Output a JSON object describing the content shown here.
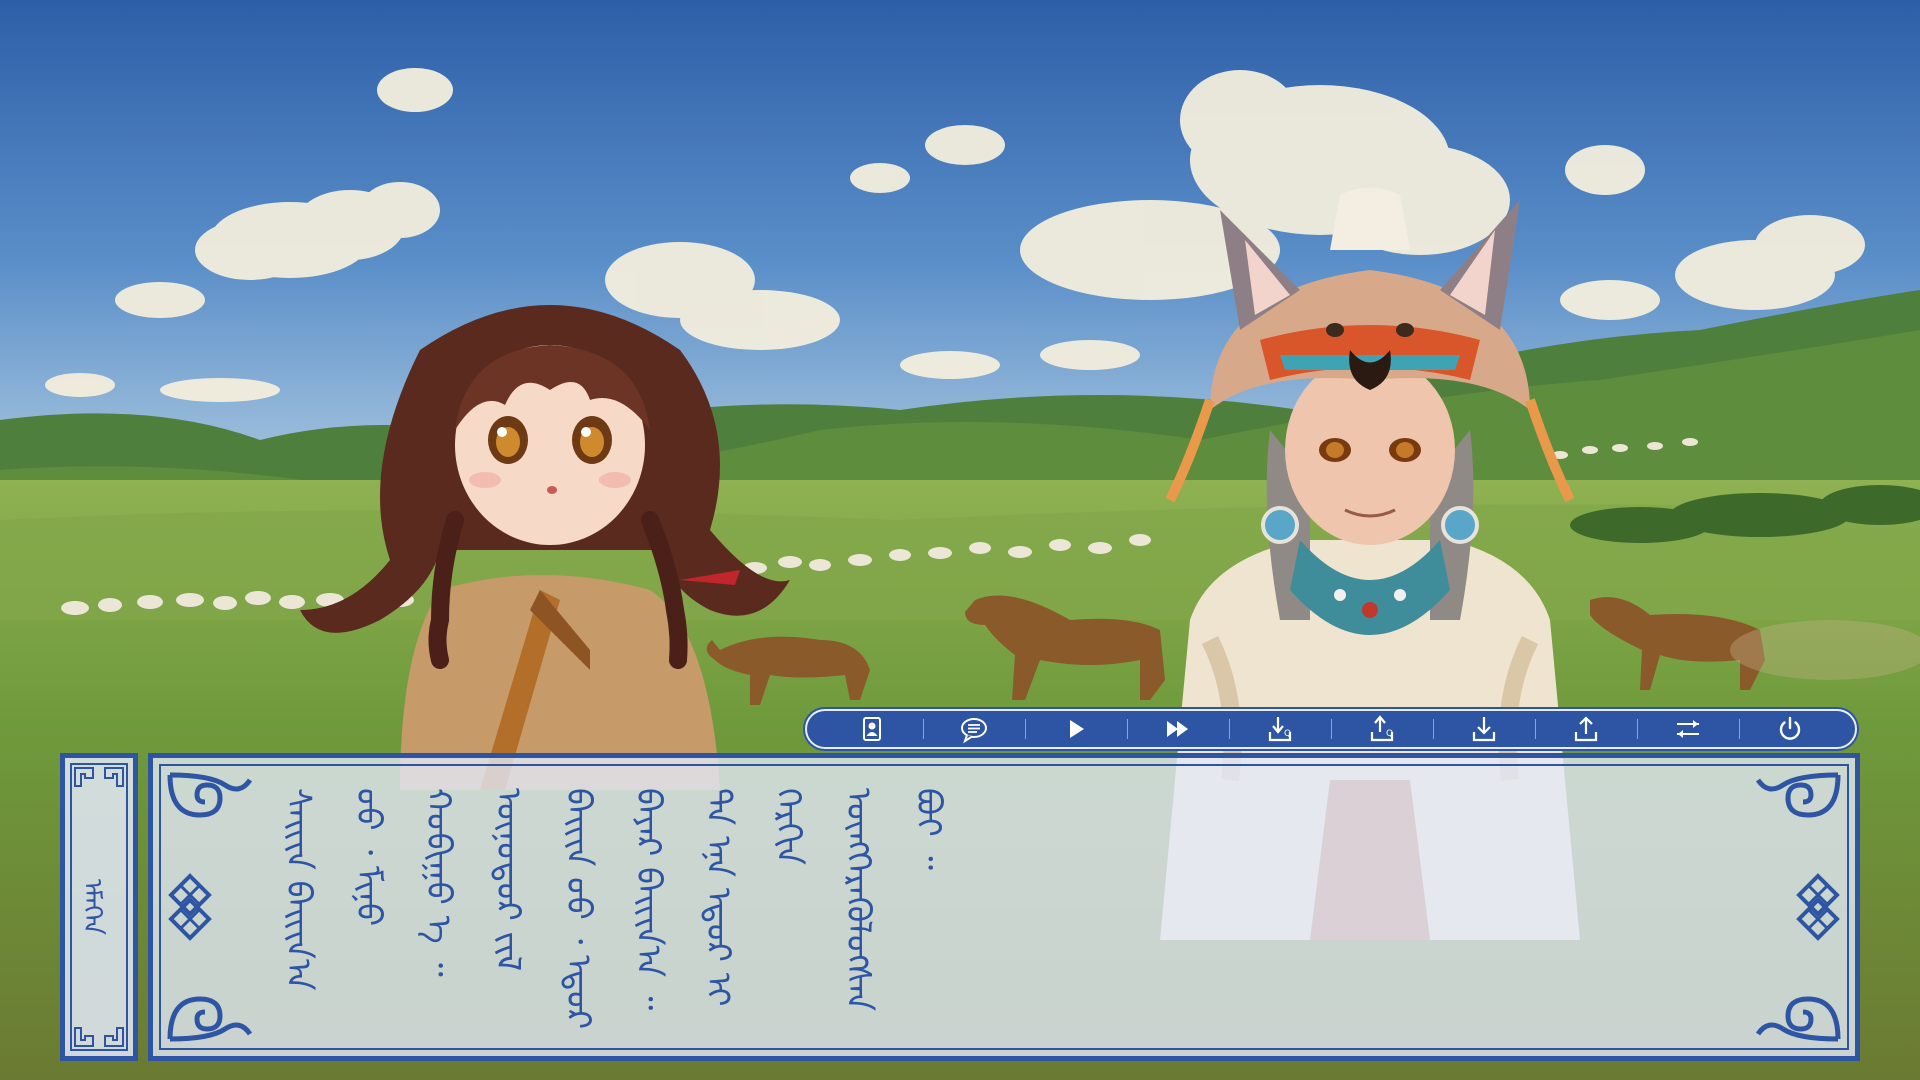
{
  "speaker": {
    "name": "ᠡᠮᠡᠭᠡᠨ"
  },
  "dialogue": {
    "text": "ᠰᠠᠢᠢᠨ ᠪᠠᠢᠢᠨ᠎ᠠ ᠤᠤ ᠂ ᠮᠢᠨᠤ ᠬᠣᠪᠢᠭᠤ ᠡ ᠃ ᠥᠨᠥᠳᠥᠷ ᠵᠢᠯ ᠪᠠᠢᠢᠨ ᠤᠤ ᠂ ᠡᠳᠦᠷ ᠪᠠᠶᠠᠷ ᠪᠠᠢᠢᠨ᠎ᠠ ᠃ ᠲᠠ ᠡᠨᠡ ᠡᠳᠦᠷ ᠢ ᠬᠡᠷᠬᠢᠨ ᠥᠩᠭᠡᠷᠡᠭᠦᠯᠦᠭᠰᠡᠨ ᠪᠤᠢ ᠃"
  },
  "toolbar": {
    "buttons": [
      {
        "id": "profile",
        "icon": "profile-icon"
      },
      {
        "id": "log",
        "icon": "speech-bubble-icon"
      },
      {
        "id": "auto",
        "icon": "play-icon"
      },
      {
        "id": "skip",
        "icon": "fast-forward-icon"
      },
      {
        "id": "quick-save",
        "icon": "quick-save-icon"
      },
      {
        "id": "quick-load",
        "icon": "quick-load-icon"
      },
      {
        "id": "save",
        "icon": "save-icon"
      },
      {
        "id": "load",
        "icon": "load-icon"
      },
      {
        "id": "settings",
        "icon": "settings-sliders-icon"
      },
      {
        "id": "exit",
        "icon": "power-icon"
      }
    ]
  },
  "colors": {
    "ui_blue": "#2e55a3",
    "panel_fill": "#e2e8f6",
    "sky": "#3a6db5",
    "grass": "#6f9a3c"
  }
}
